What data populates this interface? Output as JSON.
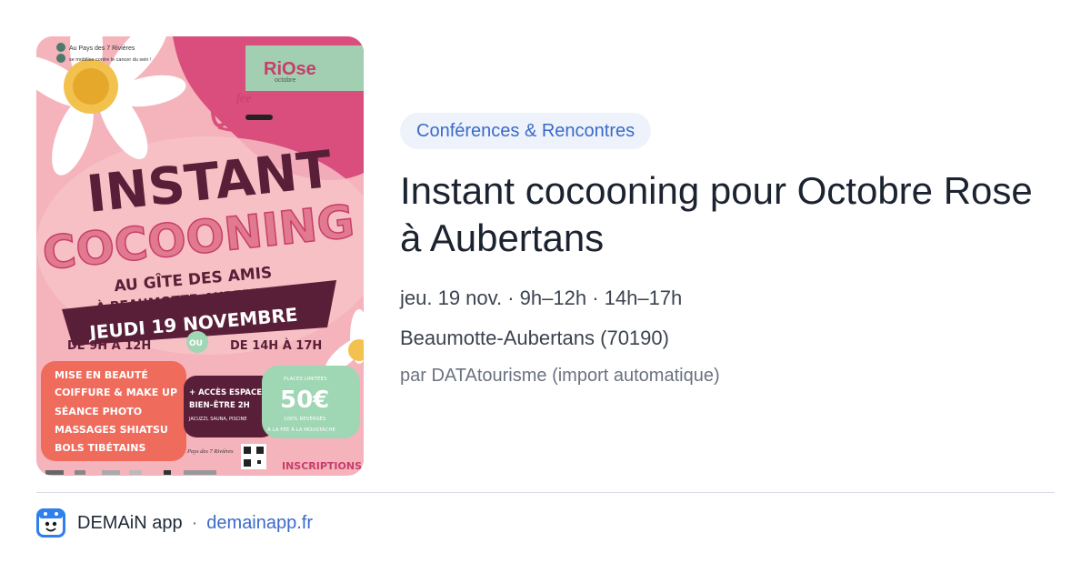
{
  "poster": {
    "header_line1": "Au Pays des 7 Rivières",
    "header_line2": "se mobilise contre le cancer du sein !",
    "badge_top": "RiOse",
    "badge_sub": "octobre",
    "fee_logo": "fee",
    "title1": "INSTANT",
    "title2": "COCOONING",
    "venue1": "AU GÎTE DES AMIS",
    "venue2": "À BEAUMOTTE–AUBERTANS",
    "date_banner": "JEUDI 19 NOVEMBRE",
    "time1": "DE 9H À 12H",
    "or": "OU",
    "time2": "DE 14H À 17H",
    "services": [
      "MISE EN BEAUTÉ",
      "COIFFURE & MAKE UP",
      "SÉANCE PHOTO",
      "MASSAGES SHIATSU",
      "BOLS TIBÉTAINS"
    ],
    "wellness1": "+ ACCÈS ESPACE",
    "wellness2": "BIEN–ÊTRE 2H",
    "wellness3": "JACUZZI, SAUNA, PISCINE",
    "price_top": "PLACES LIMITÉES",
    "price": "50€",
    "price_note1": "100% REVERSÉS",
    "price_note2": "À LA FÉE À LA MOUSTACHE",
    "signature": "Pays des 7 Rivières",
    "signup": "INSCRIPTIONS",
    "colors": {
      "bg": "#f4a5b0",
      "pink_dark": "#d94e7c",
      "plum": "#5a1f38",
      "coral": "#ef6b5b",
      "mint": "#9fd6b4"
    }
  },
  "event": {
    "category": "Conférences & Rencontres",
    "title": "Instant cocooning pour Octobre Rose à Aubertans",
    "date": "jeu. 19 nov. · 9h–12h · 14h–17h",
    "place": "Beaumotte-Aubertans (70190)",
    "source": "par DATAtourisme (import automatique)"
  },
  "footer": {
    "app_name": "DEMAiN app",
    "separator": "·",
    "link": "demainapp.fr",
    "icon": "demain-app-icon"
  }
}
